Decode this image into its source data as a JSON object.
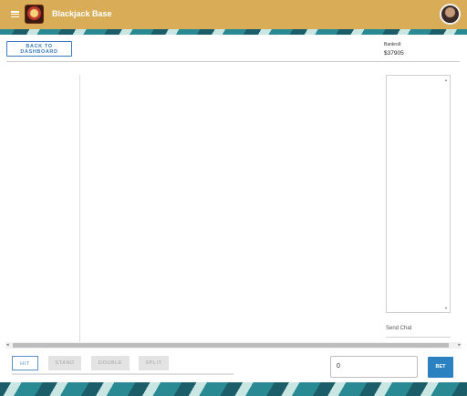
{
  "appbar": {
    "title": "Blackjack Base",
    "menu_icon": "menu-icon",
    "logo_icon": "blackjack-logo",
    "avatar_icon": "user-avatar",
    "color": "#d9ad57"
  },
  "top": {
    "back_label": "BACK TO DASHBOARD",
    "bankroll_label": "Bankroll:",
    "bankroll_value": "$37905"
  },
  "chat": {
    "send_label": "Send Chat"
  },
  "actions": {
    "hit": "HIT",
    "stand": "STAND",
    "double": "DOUBLE",
    "split": "SPLIT"
  },
  "bet": {
    "value": "0",
    "button_label": "BET",
    "accent": "#2c82c0"
  }
}
